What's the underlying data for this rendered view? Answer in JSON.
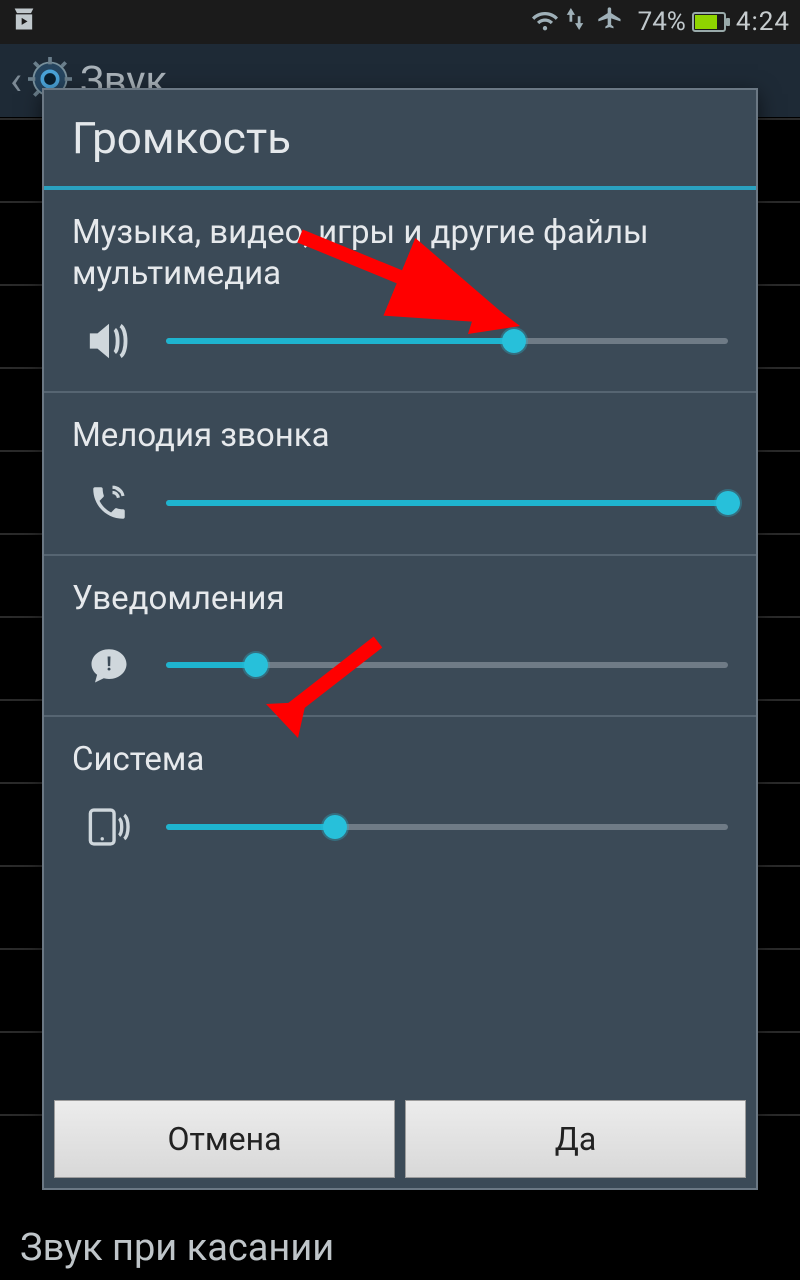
{
  "statusbar": {
    "battery_percent_label": "74%",
    "battery_level": 74,
    "time": "4:24"
  },
  "header": {
    "title": "Звук"
  },
  "background": {
    "touch_sound_label": "Звук при касании"
  },
  "dialog": {
    "title": "Громкость",
    "sections": [
      {
        "label": "Музыка, видео, игры и другие файлы мультимедиа",
        "icon": "speaker-icon",
        "value": 62
      },
      {
        "label": "Мелодия звонка",
        "icon": "phone-icon",
        "value": 100
      },
      {
        "label": "Уведомления",
        "icon": "notification-icon",
        "value": 16
      },
      {
        "label": "Система",
        "icon": "device-icon",
        "value": 30
      }
    ],
    "buttons": {
      "cancel": "Отмена",
      "ok": "Да"
    }
  },
  "colors": {
    "accent": "#1eb4cf",
    "arrow": "#ff0000"
  }
}
